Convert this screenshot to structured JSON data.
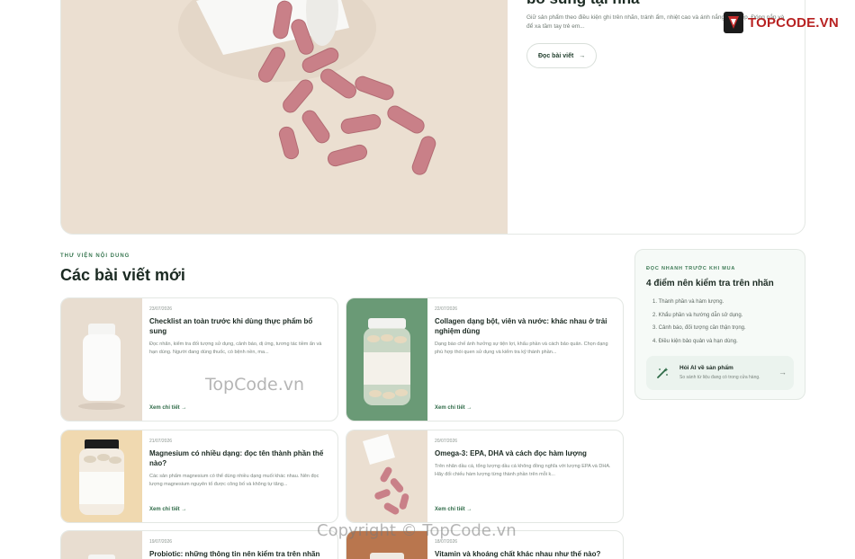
{
  "hero": {
    "title": "bổ sung tại nhà",
    "description": "Giữ sản phẩm theo điều kiện ghi trên nhãn, tránh ẩm, nhiệt cao và ánh nắng trực tiếp. Đóng nắp và để xa tầm tay trẻ em...",
    "button_label": "Đọc bài viết",
    "button_icon": "arrow-right-icon"
  },
  "brand": {
    "name": "TOPCODE.VN",
    "color": "#b82222"
  },
  "section": {
    "eyebrow": "THƯ VIỆN NỘI DUNG",
    "title": "Các bài viết mới"
  },
  "articles": [
    {
      "date": "23/07/2026",
      "title": "Checklist an toàn trước khi dùng thực phẩm bổ sung",
      "excerpt": "Đọc nhãn, kiểm tra đối tượng sử dụng, cảnh báo, dị ứng, tương tác tiềm ẩn và hạn dùng. Người đang dùng thuốc, có bệnh nền, ma...",
      "link": "Xem chi tiết",
      "thumb": "white-bottle"
    },
    {
      "date": "22/07/2026",
      "title": "Collagen dạng bột, viên và nước: khác nhau ở trải nghiệm dùng",
      "excerpt": "Dạng bào chế ảnh hưởng sự tiện lợi, khẩu phần và cách bảo quản. Chọn dạng phù hợp thói quen sử dụng và kiểm tra kỹ thành phần...",
      "link": "Xem chi tiết",
      "thumb": "glass-jar-green"
    },
    {
      "date": "21/07/2026",
      "title": "Magnesium có nhiều dạng: đọc tên thành phần thế nào?",
      "excerpt": "Các sản phẩm magnesium có thể dùng nhiều dạng muối khác nhau. Nên đọc lượng magnesium nguyên tố được công bố và không tự tăng...",
      "link": "Xem chi tiết",
      "thumb": "jar-black-cap"
    },
    {
      "date": "20/07/2026",
      "title": "Omega-3: EPA, DHA và cách đọc hàm lượng",
      "excerpt": "Trên nhãn dầu cá, tổng lượng dầu cá không đồng nghĩa với lượng EPA và DHA. Hãy đối chiếu hàm lượng từng thành phần trên mỗi k...",
      "link": "Xem chi tiết",
      "thumb": "spilled-pills"
    },
    {
      "date": "19/07/2026",
      "title": "Probiotic: những thông tin nên kiểm tra trên nhãn",
      "excerpt": "",
      "link": "",
      "thumb": "white-bottle"
    },
    {
      "date": "18/07/2026",
      "title": "Vitamin và khoáng chất khác nhau như thế nào?",
      "excerpt": "",
      "link": "",
      "thumb": "glass-jar-brown"
    }
  ],
  "panel": {
    "eyebrow": "ĐỌC NHANH TRƯỚC KHI MUA",
    "title": "4 điểm nên kiểm tra trên nhãn",
    "items": [
      "1. Thành phần và hàm lượng.",
      "2. Khẩu phần và hướng dẫn sử dụng.",
      "3. Cảnh báo, đối tượng cần thận trọng.",
      "4. Điều kiện bảo quản và hạn dùng."
    ],
    "ai": {
      "title": "Hỏi AI về sản phẩm",
      "subtitle": "So sánh từ liệu đang có trong cửa hàng.",
      "icon": "magic-wand-icon",
      "arrow_icon": "arrow-right-icon"
    }
  },
  "watermarks": [
    "TopCode.vn",
    "Copyright © TopCode.vn"
  ],
  "colors": {
    "accent": "#2f6b48",
    "eyebrow": "#3d7a55",
    "panel_bg": "#f6faf7"
  }
}
